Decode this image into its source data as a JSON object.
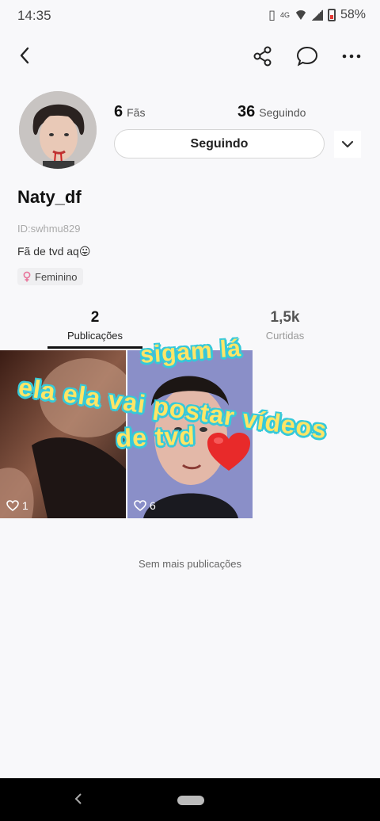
{
  "status_bar": {
    "time": "14:35",
    "network": "4G",
    "battery": "58%"
  },
  "nav": {
    "back": "back-icon",
    "share": "share-icon",
    "chat": "chat-icon",
    "more": "more-icon"
  },
  "profile": {
    "fans_count": "6",
    "fans_label": "Fãs",
    "following_count": "36",
    "following_label": "Seguindo",
    "follow_button": "Seguindo",
    "name": "Naty_df",
    "id": "ID:swhmu829",
    "bio": "Fã de tvd aq😛",
    "gender": "Feminino"
  },
  "tabs": [
    {
      "num": "2",
      "label": "Publicações"
    },
    {
      "num": "1,5k",
      "label": "Curtidas"
    }
  ],
  "posts": [
    {
      "likes": "1"
    },
    {
      "likes": "6"
    }
  ],
  "no_more": "Sem mais publicações",
  "overlay": {
    "line1": "sigam lá",
    "line2": "ela ela vai postar vídeos",
    "line3": "de tvd"
  },
  "colors": {
    "overlay_text": "#ffe566",
    "overlay_outline": "#36c9d9",
    "heart": "#e82a2a"
  }
}
